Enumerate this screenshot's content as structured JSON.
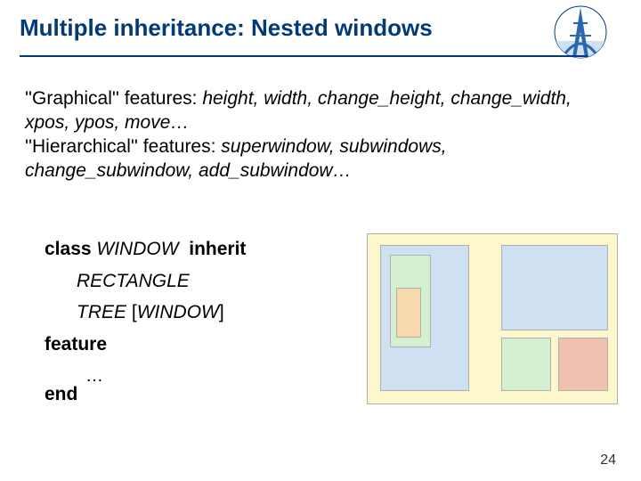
{
  "title": "Multiple inheritance: Nested windows",
  "logo_name": "eiffel-logo",
  "features": {
    "graphical_label": "''Graphical'' features:",
    "graphical_list": "height, width, change_height, change_width, xpos, ypos, move…",
    "hierarchical_label": "''Hierarchical'' features:",
    "hierarchical_list": "superwindow, subwindows, change_subwindow, add_subwindow…"
  },
  "code": {
    "kw_class": "class",
    "cls_window": "WINDOW",
    "kw_inherit": "inherit",
    "cls_rectangle": "RECTANGLE",
    "cls_tree": "TREE",
    "lbrack": "[",
    "cls_window2": "WINDOW",
    "rbrack": "]",
    "kw_feature": "feature",
    "ellipsis": "…",
    "kw_end": "end"
  },
  "page_number": "24"
}
